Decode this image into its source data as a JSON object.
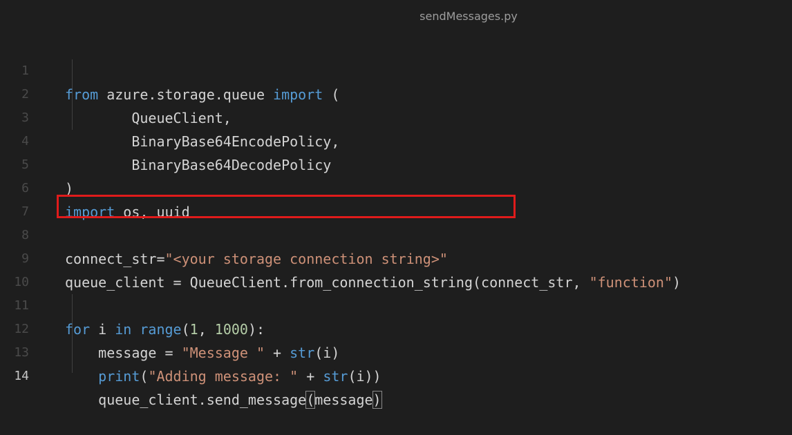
{
  "tab": {
    "title": "sendMessages.py"
  },
  "editor": {
    "line_numbers": [
      "1",
      "2",
      "3",
      "4",
      "5",
      "6",
      "7",
      "8",
      "9",
      "10",
      "11",
      "12",
      "13",
      "14"
    ],
    "lines": {
      "l1": {
        "kw_from": "from",
        "mod": " azure.storage.queue ",
        "kw_import": "import",
        "rest": " ("
      },
      "l2": {
        "text": "        QueueClient,"
      },
      "l3": {
        "text": "        BinaryBase64EncodePolicy,"
      },
      "l4": {
        "text": "        BinaryBase64DecodePolicy"
      },
      "l5": {
        "text": ")"
      },
      "l6": {
        "kw_import": "import",
        "rest": " os, uuid"
      },
      "l8": {
        "var": "connect_str=",
        "str": "\"<your storage connection string>\""
      },
      "l9": {
        "pre": "queue_client = QueueClient.from_connection_string(connect_str, ",
        "str": "\"function\"",
        "post": ")"
      },
      "l11": {
        "kw_for": "for",
        "a": " i ",
        "kw_in": "in",
        "sp": " ",
        "range": "range",
        "open": "(",
        "n1": "1",
        "comma": ", ",
        "n2": "1000",
        "close": "):"
      },
      "l12": {
        "pre": "    message = ",
        "str": "\"Message \"",
        "mid": " + ",
        "fn": "str",
        "post": "(i)"
      },
      "l13": {
        "pad": "    ",
        "fn": "print",
        "open": "(",
        "str": "\"Adding message: \"",
        "mid": " + ",
        "fn2": "str",
        "post": "(i))"
      },
      "l14": {
        "pre": "    queue_client.send_message",
        "open": "(",
        "arg": "message",
        "close": ")"
      }
    }
  },
  "colors": {
    "background": "#1e1e1e",
    "keyword": "#569cd6",
    "string": "#ce9178",
    "number": "#b5cea8",
    "highlight_box": "#e01b1b"
  }
}
